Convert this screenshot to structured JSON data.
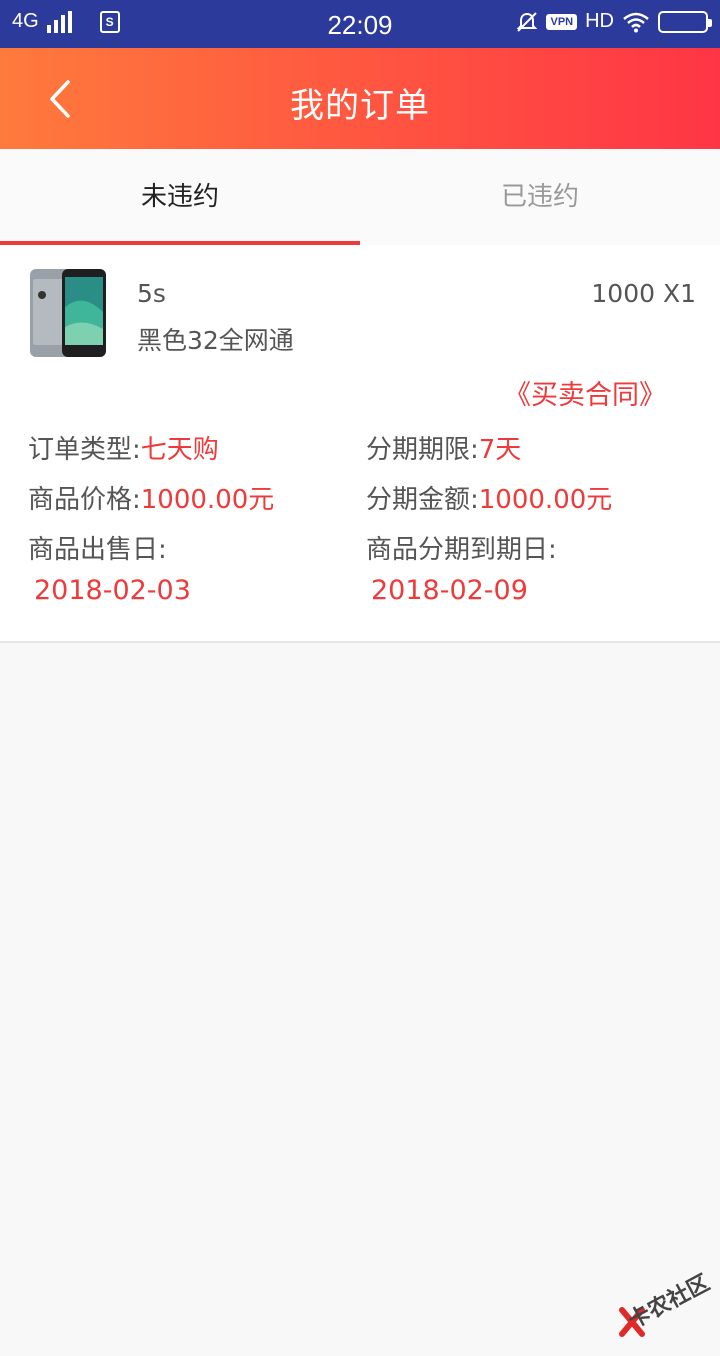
{
  "status_bar": {
    "network": "4G",
    "sim_label": "S",
    "time": "22:09",
    "vpn": "VPN",
    "hd": "HD"
  },
  "header": {
    "title": "我的订单"
  },
  "tabs": [
    {
      "label": "未违约",
      "active": true
    },
    {
      "label": "已违约",
      "active": false
    }
  ],
  "order": {
    "product_name": "5s",
    "product_spec": "黑色32全网通",
    "price_qty": "1000 X1",
    "contract_link": "《买卖合同》",
    "order_type_label": "订单类型:",
    "order_type_value": "七天购",
    "term_label": "分期期限:",
    "term_value": "7天",
    "price_label": "商品价格:",
    "price_value": "1000.00元",
    "installment_label": "分期金额:",
    "installment_value": "1000.00元",
    "sale_date_label": "商品出售日:",
    "sale_date": "2018-02-03",
    "due_date_label": "商品分期到期日:",
    "due_date": "2018-02-09"
  },
  "watermark": "卡农社区",
  "colors": {
    "status_bar": "#2c3a9c",
    "accent_red": "#ee3a3a",
    "header_gradient_start": "#ff7a3c",
    "header_gradient_end": "#ff3545"
  }
}
